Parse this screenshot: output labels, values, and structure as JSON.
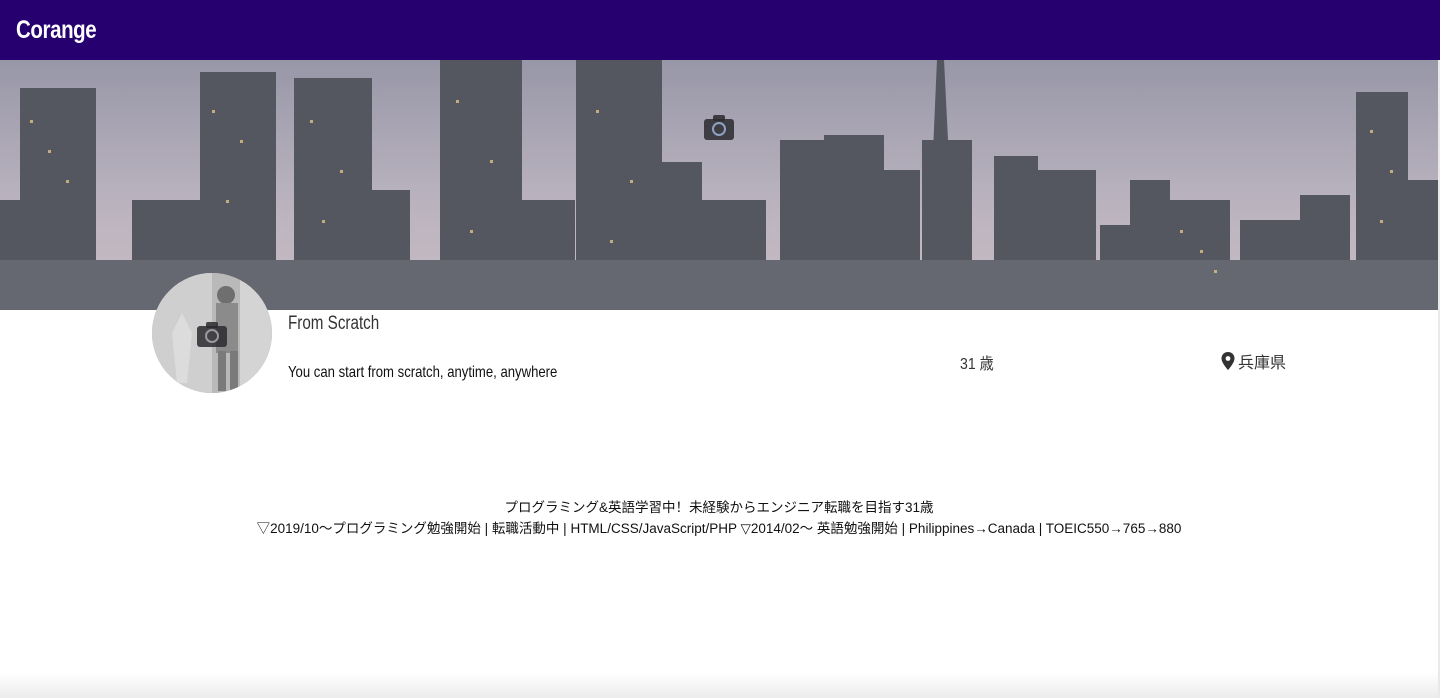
{
  "navbar": {
    "brand": "Corange"
  },
  "cover": {
    "camera_icon": "camera-icon"
  },
  "profile": {
    "avatar_camera_icon": "camera-icon",
    "name": "From Scratch",
    "tagline": "You can start from scratch, anytime, anywhere",
    "age": "31 歳",
    "location_icon": "map-marker-icon",
    "location": "兵庫県"
  },
  "bio": {
    "line1": "プログラミング&英語学習中！未経験からエンジニア転職を目指す31歳",
    "line2": "▽2019/10〜プログラミング勉強開始 | 転職活動中 | HTML/CSS/JavaScript/PHP ▽2014/02〜 英語勉強開始 | Philippines→Canada | TOEIC550→765→880"
  },
  "colors": {
    "navbar_bg": "#25006e",
    "brand_text": "#ffffff"
  }
}
